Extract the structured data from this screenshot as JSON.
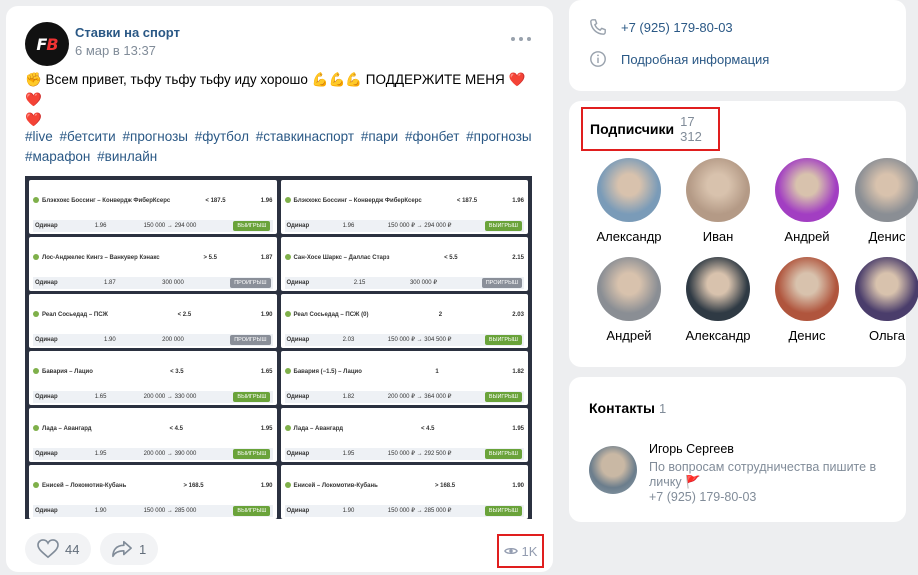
{
  "post": {
    "author": "Ставки на спорт",
    "logo_text_1": "F",
    "logo_text_2": "B",
    "date": "6 мар в 13:37",
    "text_line1": "✊ Всем привет, тьфу тьфу тьфу иду хорошо 💪💪💪 ПОДДЕРЖИТЕ МЕНЯ ❤️❤️",
    "text_line2": "❤️",
    "hashtags": [
      "#live",
      "#бетсити",
      "#прогнозы",
      "#футбол",
      "#ставкинаспорт",
      "#пари",
      "#фонбет",
      "#прогнозы",
      "#марафон",
      "#винлайн"
    ],
    "likes": "44",
    "shares": "1",
    "views": "1K",
    "image": {
      "left_column": [
        {
          "event": "Блэкхокс Боссинг – Конвердж ФиберКсерс",
          "market": "< 187.5",
          "odds": "1.96",
          "type": "Одинар",
          "coef": "1.96",
          "payout": "150 000 → 294 000",
          "result": "ВЫИГРЫШ",
          "win": true
        },
        {
          "event": "Лос-Анджелес Кингз – Ванкувер Кэнакс",
          "market": "> 5.5",
          "odds": "1.87",
          "type": "Одинар",
          "coef": "1.87",
          "payout": "300 000",
          "result": "ПРОИГРЫШ",
          "win": false
        },
        {
          "event": "Реал Сосьедад – ПСЖ",
          "market": "< 2.5",
          "odds": "1.90",
          "type": "Одинар",
          "coef": "1.90",
          "payout": "200 000",
          "result": "ПРОИГРЫШ",
          "win": false
        },
        {
          "event": "Бавария – Лацио",
          "market": "< 3.5",
          "odds": "1.65",
          "type": "Одинар",
          "coef": "1.65",
          "payout": "200 000 → 330 000",
          "result": "ВЫИГРЫШ",
          "win": true
        },
        {
          "event": "Лада – Авангард",
          "market": "< 4.5",
          "odds": "1.95",
          "type": "Одинар",
          "coef": "1.95",
          "payout": "200 000 → 390 000",
          "result": "ВЫИГРЫШ",
          "win": true
        },
        {
          "event": "Енисей – Локомотив-Кубань",
          "market": "> 168.5",
          "odds": "1.90",
          "type": "Одинар",
          "coef": "1.90",
          "payout": "150 000 → 285 000",
          "result": "ВЫИГРЫШ",
          "win": true
        }
      ],
      "right_column": [
        {
          "event": "Блэкхокс Боссинг – Конвердж ФиберКсерс",
          "market": "< 187.5",
          "odds": "1.96",
          "type": "Одинар",
          "coef": "1.96",
          "payout": "150 000 ₽ → 294 000 ₽",
          "result": "ВЫИГРЫШ",
          "win": true
        },
        {
          "event": "Сан-Хосе Шаркс – Даллас Старз",
          "market": "< 5.5",
          "odds": "2.15",
          "type": "Одинар",
          "coef": "2.15",
          "payout": "300 000 ₽",
          "result": "ПРОИГРЫШ",
          "win": false
        },
        {
          "event": "Реал Сосьедад – ПСЖ (0)",
          "market": "2",
          "odds": "2.03",
          "type": "Одинар",
          "coef": "2.03",
          "payout": "150 000 ₽ → 304 500 ₽",
          "result": "ВЫИГРЫШ",
          "win": true
        },
        {
          "event": "Бавария (−1.5) – Лацио",
          "market": "1",
          "odds": "1.82",
          "type": "Одинар",
          "coef": "1.82",
          "payout": "200 000 ₽ → 364 000 ₽",
          "result": "ВЫИГРЫШ",
          "win": true
        },
        {
          "event": "Лада – Авангард",
          "market": "< 4.5",
          "odds": "1.95",
          "type": "Одинар",
          "coef": "1.95",
          "payout": "150 000 ₽ → 292 500 ₽",
          "result": "ВЫИГРЫШ",
          "win": true
        },
        {
          "event": "Енисей – Локомотив-Кубань",
          "market": "> 168.5",
          "odds": "1.90",
          "type": "Одинар",
          "coef": "1.90",
          "payout": "150 000 ₽ → 285 000 ₽",
          "result": "ВЫИГРЫШ",
          "win": true
        }
      ]
    }
  },
  "info": {
    "phone": "+7 (925) 179-80-03",
    "details": "Подробная информация"
  },
  "subscribers": {
    "title": "Подписчики",
    "count": "17 312",
    "people": [
      {
        "name": "Александр",
        "color": "#7a9bb8"
      },
      {
        "name": "Иван",
        "color": "#b49a86"
      },
      {
        "name": "Андрей",
        "color": "#a23ec2"
      },
      {
        "name": "Денис",
        "color": "#8a8e94"
      },
      {
        "name": "Андрей",
        "color": "#8a8e94"
      },
      {
        "name": "Александр",
        "color": "#2f3a44"
      },
      {
        "name": "Денис",
        "color": "#b0553d"
      },
      {
        "name": "Ольга",
        "color": "#4a3d6b"
      }
    ]
  },
  "contacts": {
    "title": "Контакты",
    "count": "1",
    "name": "Игорь Сергеев",
    "description": "По вопросам сотрудничества пишите в личку 🚩",
    "phone": "+7 (925) 179-80-03"
  }
}
